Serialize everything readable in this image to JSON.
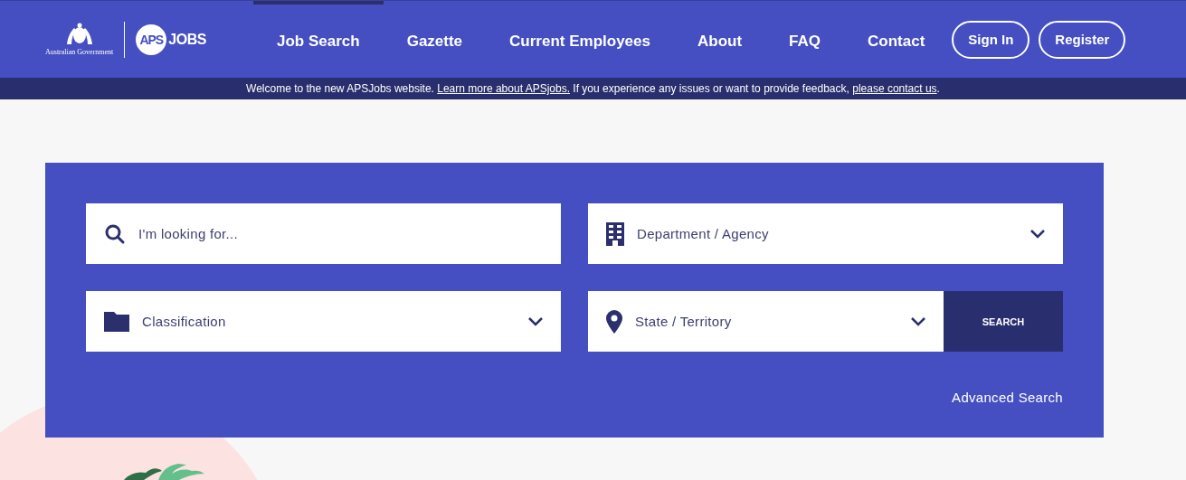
{
  "header": {
    "logo": {
      "government": "Australian Government",
      "badge": "APS",
      "wordmark": "JOBS"
    },
    "nav": [
      {
        "label": "Job Search",
        "selected": true
      },
      {
        "label": "Gazette",
        "selected": false
      },
      {
        "label": "Current Employees",
        "selected": false
      },
      {
        "label": "About",
        "selected": false
      },
      {
        "label": "FAQ",
        "selected": false
      },
      {
        "label": "Contact",
        "selected": false
      }
    ],
    "buttons": [
      "Sign In",
      "Register"
    ]
  },
  "notice": [
    {
      "kind": "text",
      "text": "Welcome to the new APSJobs website. "
    },
    {
      "kind": "link",
      "text": "Learn more about APSjobs."
    },
    {
      "kind": "text",
      "text": " If you experience any issues or want to provide feedback, "
    },
    {
      "kind": "link",
      "text": "please contact us"
    },
    {
      "kind": "text",
      "text": "."
    }
  ],
  "search": {
    "fields": [
      {
        "kind": "input",
        "placeholder": "I'm looking for..."
      },
      {
        "kind": "select",
        "placeholder": "Department / Agency"
      },
      {
        "kind": "select",
        "placeholder": "Classification"
      },
      {
        "kind": "select",
        "placeholder": "State / Territory"
      }
    ],
    "button": "SEARCH",
    "advanced": "Advanced Search"
  }
}
